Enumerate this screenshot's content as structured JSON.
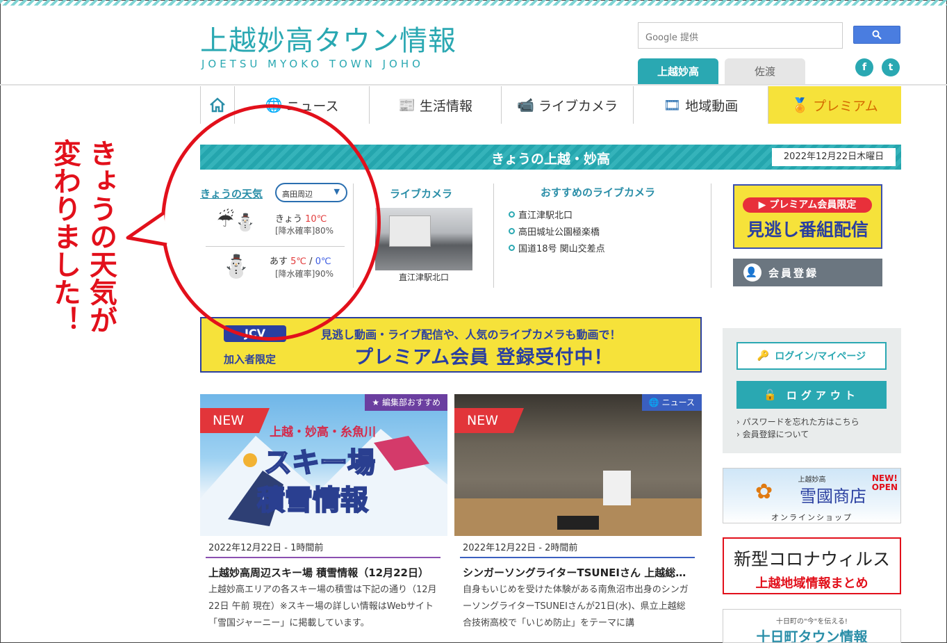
{
  "header": {
    "logo_jp": "上越妙高タウン情報",
    "logo_en": "JOETSU MYOKO TOWN JOHO",
    "search_provider": "Google 提供",
    "region_tabs": [
      {
        "label": "上越妙高",
        "active": true
      },
      {
        "label": "佐渡",
        "active": false
      }
    ],
    "social": {
      "facebook": "f",
      "twitter": "t"
    }
  },
  "nav": {
    "items": [
      {
        "label": "",
        "icon": "home-icon"
      },
      {
        "label": "ニュース",
        "icon": "globe-icon"
      },
      {
        "label": "生活情報",
        "icon": "newspaper-icon"
      },
      {
        "label": "ライブカメラ",
        "icon": "camera-icon"
      },
      {
        "label": "地域動画",
        "icon": "video-icon"
      },
      {
        "label": "プレミアム",
        "icon": "medal-icon"
      }
    ]
  },
  "today": {
    "title": "きょうの上越・妙高",
    "date": "2022年12月22日木曜日"
  },
  "weather": {
    "title": "きょうの天気",
    "area": "高田周辺",
    "today": {
      "label": "きょう",
      "high": "10℃",
      "rain": "[降水確率]80%"
    },
    "tomorrow": {
      "label": "あす",
      "high": "5℃",
      "sep": " / ",
      "low": "0℃",
      "rain": "[降水確率]90%"
    }
  },
  "livecam": {
    "title": "ライブカメラ",
    "caption": "直江津駅北口"
  },
  "recommended": {
    "title": "おすすめのライブカメラ",
    "items": [
      "直江津駅北口",
      "高田城址公園極楽橋",
      "国道18号 関山交差点"
    ]
  },
  "premium": {
    "tag": "プレミアム会員限定",
    "main": "見逃し番組配信",
    "member_button": "会員登録"
  },
  "banner": {
    "jcv": "JCV",
    "limited": "加入者限定",
    "top": "見逃し動画・ライブ配信や、人気のライブカメラも動画で！",
    "main": "プレミアム会員 登録受付中！"
  },
  "callout": {
    "line1": "きょうの天気が",
    "line2": "変わりました！"
  },
  "cards": [
    {
      "tag": "編集部おすすめ",
      "new_label": "NEW",
      "image_text_top": "上越・妙高・糸魚川",
      "image_text_1": "スキー場",
      "image_text_2": "積雪情報",
      "date": "2022年12月22日 - 1時間前",
      "title": "上越妙高周辺スキー場 積雪情報（12月22日）",
      "body": "上越妙高エリアの各スキー場の積雪は下記の通り（12月22日 午前 現在）※スキー場の詳しい情報はWebサイト「雪国ジャーニー」に掲載しています。"
    },
    {
      "tag": "ニュース",
      "new_label": "NEW",
      "date": "2022年12月22日 - 2時間前",
      "title": "シンガーソングライターTSUNEIさん 上越総合技術高校で講演",
      "body": "自身もいじめを受けた体験がある南魚沼市出身のシンガーソングライターTSUNEIさんが21日(水)、県立上越総合技術高校で「いじめ防止」をテーマに講"
    }
  ],
  "sidebar": {
    "login": "ログイン/マイページ",
    "logout": "ログアウト",
    "link_password": "パスワードを忘れた方はこちら",
    "link_member": "会員登録について",
    "shop_small": "上越妙高",
    "shop_main": "雪國商店",
    "shop_new": "NEW!\nOPEN",
    "shop_sub": "オンラインショップ",
    "covid_main": "新型コロナウィルス",
    "covid_sub": "上越地域情報まとめ",
    "toka_small": "十日町の\"今\"を伝える!",
    "toka_main": "十日町タウン情報"
  },
  "colors": {
    "brand": "#2aa8b2",
    "premium_yellow": "#f6e23a",
    "callout_red": "#e2101b",
    "navy": "#2a3fa0"
  }
}
